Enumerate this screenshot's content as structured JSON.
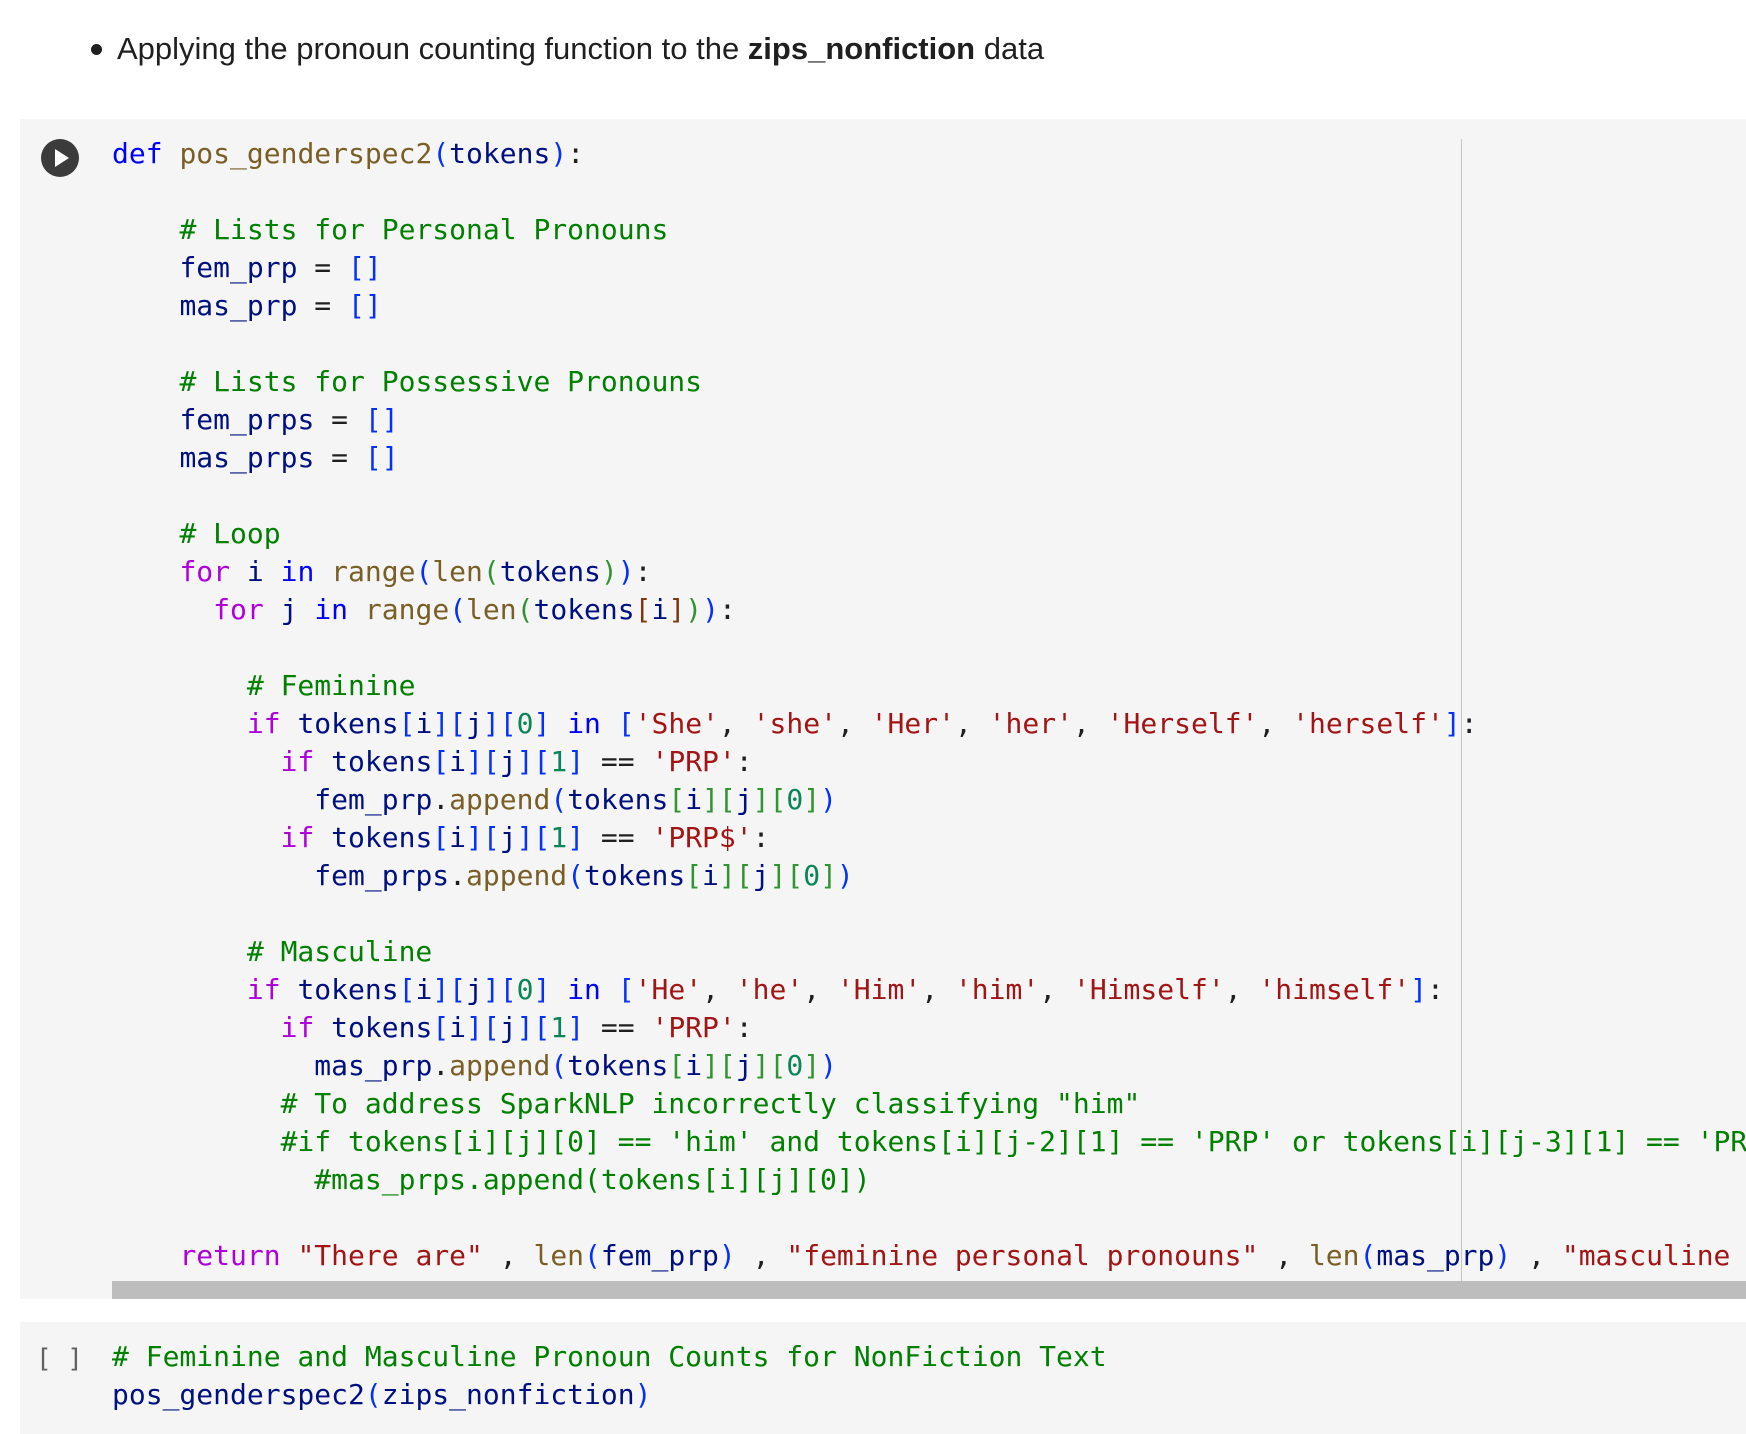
{
  "bullet": {
    "prefix": "Applying the pronoun counting function to the ",
    "bold": "zips_nonfiction",
    "suffix": " data"
  },
  "cell1": {
    "run_icon": "play-icon",
    "lines": [
      [
        [
          "kw",
          "def"
        ],
        [
          "pl",
          " "
        ],
        [
          "fn",
          "pos_genderspec2"
        ],
        [
          "br1",
          "("
        ],
        [
          "var",
          "tokens"
        ],
        [
          "br1",
          ")"
        ],
        [
          "pl",
          ":"
        ]
      ],
      [],
      [
        [
          "pl",
          "    "
        ],
        [
          "com",
          "# Lists for Personal Pronouns"
        ]
      ],
      [
        [
          "pl",
          "    "
        ],
        [
          "var",
          "fem_prp"
        ],
        [
          "pl",
          " = "
        ],
        [
          "br1",
          "[]"
        ]
      ],
      [
        [
          "pl",
          "    "
        ],
        [
          "var",
          "mas_prp"
        ],
        [
          "pl",
          " = "
        ],
        [
          "br1",
          "[]"
        ]
      ],
      [],
      [
        [
          "pl",
          "    "
        ],
        [
          "com",
          "# Lists for Possessive Pronouns"
        ]
      ],
      [
        [
          "pl",
          "    "
        ],
        [
          "var",
          "fem_prps"
        ],
        [
          "pl",
          " = "
        ],
        [
          "br1",
          "[]"
        ]
      ],
      [
        [
          "pl",
          "    "
        ],
        [
          "var",
          "mas_prps"
        ],
        [
          "pl",
          " = "
        ],
        [
          "br1",
          "[]"
        ]
      ],
      [],
      [
        [
          "pl",
          "    "
        ],
        [
          "com",
          "# Loop"
        ]
      ],
      [
        [
          "pl",
          "    "
        ],
        [
          "ctl",
          "for"
        ],
        [
          "pl",
          " "
        ],
        [
          "var",
          "i"
        ],
        [
          "pl",
          " "
        ],
        [
          "kw",
          "in"
        ],
        [
          "pl",
          " "
        ],
        [
          "fn",
          "range"
        ],
        [
          "br1",
          "("
        ],
        [
          "fn",
          "len"
        ],
        [
          "br2",
          "("
        ],
        [
          "var",
          "tokens"
        ],
        [
          "br2",
          ")"
        ],
        [
          "br1",
          ")"
        ],
        [
          "pl",
          ":"
        ]
      ],
      [
        [
          "pl",
          "      "
        ],
        [
          "ctl",
          "for"
        ],
        [
          "pl",
          " "
        ],
        [
          "var",
          "j"
        ],
        [
          "pl",
          " "
        ],
        [
          "kw",
          "in"
        ],
        [
          "pl",
          " "
        ],
        [
          "fn",
          "range"
        ],
        [
          "br1",
          "("
        ],
        [
          "fn",
          "len"
        ],
        [
          "br2",
          "("
        ],
        [
          "var",
          "tokens"
        ],
        [
          "br3",
          "["
        ],
        [
          "var",
          "i"
        ],
        [
          "br3",
          "]"
        ],
        [
          "br2",
          ")"
        ],
        [
          "br1",
          ")"
        ],
        [
          "pl",
          ":"
        ]
      ],
      [],
      [
        [
          "pl",
          "        "
        ],
        [
          "com",
          "# Feminine"
        ]
      ],
      [
        [
          "pl",
          "        "
        ],
        [
          "ctl",
          "if"
        ],
        [
          "pl",
          " "
        ],
        [
          "var",
          "tokens"
        ],
        [
          "br1",
          "["
        ],
        [
          "var",
          "i"
        ],
        [
          "br1",
          "]"
        ],
        [
          "br1",
          "["
        ],
        [
          "var",
          "j"
        ],
        [
          "br1",
          "]"
        ],
        [
          "br1",
          "["
        ],
        [
          "num",
          "0"
        ],
        [
          "br1",
          "]"
        ],
        [
          "pl",
          " "
        ],
        [
          "kw",
          "in"
        ],
        [
          "pl",
          " "
        ],
        [
          "br1",
          "["
        ],
        [
          "str",
          "'She'"
        ],
        [
          "pl",
          ", "
        ],
        [
          "str",
          "'she'"
        ],
        [
          "pl",
          ", "
        ],
        [
          "str",
          "'Her'"
        ],
        [
          "pl",
          ", "
        ],
        [
          "str",
          "'her'"
        ],
        [
          "pl",
          ", "
        ],
        [
          "str",
          "'Herself'"
        ],
        [
          "pl",
          ", "
        ],
        [
          "str",
          "'herself'"
        ],
        [
          "br1",
          "]"
        ],
        [
          "pl",
          ":"
        ]
      ],
      [
        [
          "pl",
          "          "
        ],
        [
          "ctl",
          "if"
        ],
        [
          "pl",
          " "
        ],
        [
          "var",
          "tokens"
        ],
        [
          "br1",
          "["
        ],
        [
          "var",
          "i"
        ],
        [
          "br1",
          "]"
        ],
        [
          "br1",
          "["
        ],
        [
          "var",
          "j"
        ],
        [
          "br1",
          "]"
        ],
        [
          "br1",
          "["
        ],
        [
          "num",
          "1"
        ],
        [
          "br1",
          "]"
        ],
        [
          "pl",
          " == "
        ],
        [
          "str",
          "'PRP'"
        ],
        [
          "pl",
          ":"
        ]
      ],
      [
        [
          "pl",
          "            "
        ],
        [
          "var",
          "fem_prp"
        ],
        [
          "pl",
          "."
        ],
        [
          "fn",
          "append"
        ],
        [
          "br1",
          "("
        ],
        [
          "var",
          "tokens"
        ],
        [
          "br2",
          "["
        ],
        [
          "var",
          "i"
        ],
        [
          "br2",
          "]"
        ],
        [
          "br2",
          "["
        ],
        [
          "var",
          "j"
        ],
        [
          "br2",
          "]"
        ],
        [
          "br2",
          "["
        ],
        [
          "num",
          "0"
        ],
        [
          "br2",
          "]"
        ],
        [
          "br1",
          ")"
        ]
      ],
      [
        [
          "pl",
          "          "
        ],
        [
          "ctl",
          "if"
        ],
        [
          "pl",
          " "
        ],
        [
          "var",
          "tokens"
        ],
        [
          "br1",
          "["
        ],
        [
          "var",
          "i"
        ],
        [
          "br1",
          "]"
        ],
        [
          "br1",
          "["
        ],
        [
          "var",
          "j"
        ],
        [
          "br1",
          "]"
        ],
        [
          "br1",
          "["
        ],
        [
          "num",
          "1"
        ],
        [
          "br1",
          "]"
        ],
        [
          "pl",
          " == "
        ],
        [
          "str",
          "'PRP$'"
        ],
        [
          "pl",
          ":"
        ]
      ],
      [
        [
          "pl",
          "            "
        ],
        [
          "var",
          "fem_prps"
        ],
        [
          "pl",
          "."
        ],
        [
          "fn",
          "append"
        ],
        [
          "br1",
          "("
        ],
        [
          "var",
          "tokens"
        ],
        [
          "br2",
          "["
        ],
        [
          "var",
          "i"
        ],
        [
          "br2",
          "]"
        ],
        [
          "br2",
          "["
        ],
        [
          "var",
          "j"
        ],
        [
          "br2",
          "]"
        ],
        [
          "br2",
          "["
        ],
        [
          "num",
          "0"
        ],
        [
          "br2",
          "]"
        ],
        [
          "br1",
          ")"
        ]
      ],
      [],
      [
        [
          "pl",
          "        "
        ],
        [
          "com",
          "# Masculine"
        ]
      ],
      [
        [
          "pl",
          "        "
        ],
        [
          "ctl",
          "if"
        ],
        [
          "pl",
          " "
        ],
        [
          "var",
          "tokens"
        ],
        [
          "br1",
          "["
        ],
        [
          "var",
          "i"
        ],
        [
          "br1",
          "]"
        ],
        [
          "br1",
          "["
        ],
        [
          "var",
          "j"
        ],
        [
          "br1",
          "]"
        ],
        [
          "br1",
          "["
        ],
        [
          "num",
          "0"
        ],
        [
          "br1",
          "]"
        ],
        [
          "pl",
          " "
        ],
        [
          "kw",
          "in"
        ],
        [
          "pl",
          " "
        ],
        [
          "br1",
          "["
        ],
        [
          "str",
          "'He'"
        ],
        [
          "pl",
          ", "
        ],
        [
          "str",
          "'he'"
        ],
        [
          "pl",
          ", "
        ],
        [
          "str",
          "'Him'"
        ],
        [
          "pl",
          ", "
        ],
        [
          "str",
          "'him'"
        ],
        [
          "pl",
          ", "
        ],
        [
          "str",
          "'Himself'"
        ],
        [
          "pl",
          ", "
        ],
        [
          "str",
          "'himself'"
        ],
        [
          "br1",
          "]"
        ],
        [
          "pl",
          ":"
        ]
      ],
      [
        [
          "pl",
          "          "
        ],
        [
          "ctl",
          "if"
        ],
        [
          "pl",
          " "
        ],
        [
          "var",
          "tokens"
        ],
        [
          "br1",
          "["
        ],
        [
          "var",
          "i"
        ],
        [
          "br1",
          "]"
        ],
        [
          "br1",
          "["
        ],
        [
          "var",
          "j"
        ],
        [
          "br1",
          "]"
        ],
        [
          "br1",
          "["
        ],
        [
          "num",
          "1"
        ],
        [
          "br1",
          "]"
        ],
        [
          "pl",
          " == "
        ],
        [
          "str",
          "'PRP'"
        ],
        [
          "pl",
          ":"
        ]
      ],
      [
        [
          "pl",
          "            "
        ],
        [
          "var",
          "mas_prp"
        ],
        [
          "pl",
          "."
        ],
        [
          "fn",
          "append"
        ],
        [
          "br1",
          "("
        ],
        [
          "var",
          "tokens"
        ],
        [
          "br2",
          "["
        ],
        [
          "var",
          "i"
        ],
        [
          "br2",
          "]"
        ],
        [
          "br2",
          "["
        ],
        [
          "var",
          "j"
        ],
        [
          "br2",
          "]"
        ],
        [
          "br2",
          "["
        ],
        [
          "num",
          "0"
        ],
        [
          "br2",
          "]"
        ],
        [
          "br1",
          ")"
        ]
      ],
      [
        [
          "pl",
          "          "
        ],
        [
          "com",
          "# To address SparkNLP incorrectly classifying \"him\""
        ]
      ],
      [
        [
          "pl",
          "          "
        ],
        [
          "com",
          "#if tokens[i][j][0] == 'him' and tokens[i][j-2][1] == 'PRP' or tokens[i][j-3][1] == 'PR"
        ]
      ],
      [
        [
          "pl",
          "            "
        ],
        [
          "com",
          "#mas_prps.append(tokens[i][j][0])"
        ]
      ],
      [],
      [
        [
          "pl",
          "    "
        ],
        [
          "ctl",
          "return"
        ],
        [
          "pl",
          " "
        ],
        [
          "str",
          "\"There are\""
        ],
        [
          "pl",
          " , "
        ],
        [
          "fn",
          "len"
        ],
        [
          "br1",
          "("
        ],
        [
          "var",
          "fem_prp"
        ],
        [
          "br1",
          ")"
        ],
        [
          "pl",
          " , "
        ],
        [
          "str",
          "\"feminine personal pronouns\""
        ],
        [
          "pl",
          " , "
        ],
        [
          "fn",
          "len"
        ],
        [
          "br1",
          "("
        ],
        [
          "var",
          "mas_prp"
        ],
        [
          "br1",
          ")"
        ],
        [
          "pl",
          " , "
        ],
        [
          "str",
          "\"masculine"
        ]
      ]
    ]
  },
  "cell2": {
    "exec_count": "[ ]",
    "lines": [
      [
        [
          "com",
          "# Feminine and Masculine Pronoun Counts for NonFiction Text"
        ]
      ],
      [
        [
          "var",
          "pos_genderspec2"
        ],
        [
          "br1",
          "("
        ],
        [
          "var",
          "zips_nonfiction"
        ],
        [
          "br1",
          ")"
        ]
      ]
    ]
  }
}
